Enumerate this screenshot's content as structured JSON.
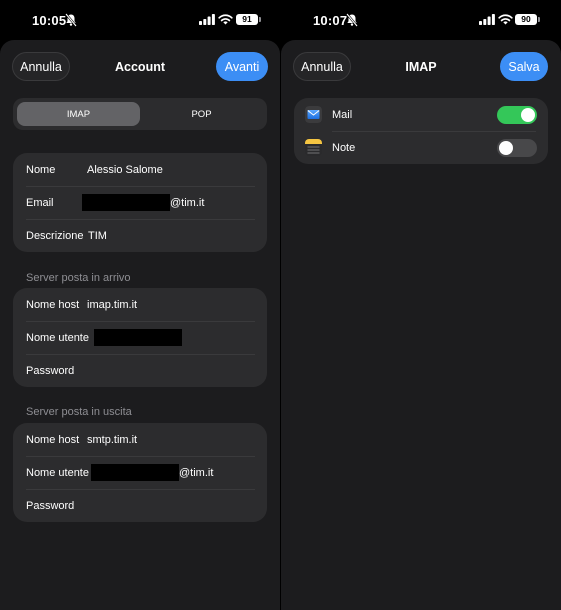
{
  "left": {
    "status": {
      "time": "10:05",
      "battery": "91"
    },
    "nav": {
      "cancel": "Annulla",
      "title": "Account",
      "next": "Avanti"
    },
    "segments": [
      "IMAP",
      "POP"
    ],
    "account": {
      "name_label": "Nome",
      "name_value": "Alessio Salome",
      "email_label": "Email",
      "email_suffix": "@tim.it",
      "desc_label": "Descrizione",
      "desc_value": "TIM"
    },
    "incoming": {
      "header": "Server posta in arrivo",
      "host_label": "Nome host",
      "host_value": "imap.tim.it",
      "user_label": "Nome utente",
      "password_label": "Password"
    },
    "outgoing": {
      "header": "Server posta in uscita",
      "host_label": "Nome host",
      "host_value": "smtp.tim.it",
      "user_label": "Nome utente",
      "user_suffix": "@tim.it",
      "password_label": "Password"
    }
  },
  "right": {
    "status": {
      "time": "10:07",
      "battery": "90"
    },
    "nav": {
      "cancel": "Annulla",
      "title": "IMAP",
      "save": "Salva"
    },
    "apps": [
      {
        "label": "Mail",
        "icon": "mail-icon",
        "enabled": true
      },
      {
        "label": "Note",
        "icon": "notes-icon",
        "enabled": false
      }
    ]
  },
  "colors": {
    "accent": "#3c8ef5",
    "toggle_on": "#34c759",
    "background": "#1c1c1e",
    "cell": "#2c2c2e"
  }
}
